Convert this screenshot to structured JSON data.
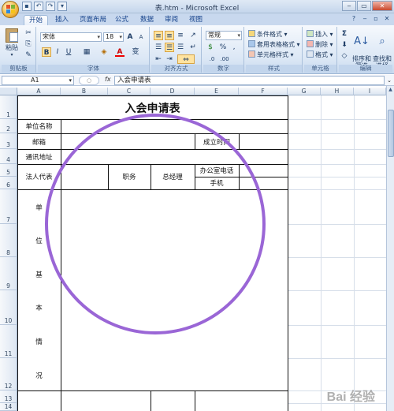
{
  "window": {
    "title": "表.htm - Microsoft Excel",
    "min": "‒",
    "max": "▭",
    "close": "✕"
  },
  "tabs": [
    "开始",
    "插入",
    "页面布局",
    "公式",
    "数据",
    "审阅",
    "视图"
  ],
  "ribbon": {
    "clipboard": {
      "label": "剪贴板",
      "paste": "粘贴"
    },
    "font": {
      "label": "字体",
      "name": "宋体",
      "size": "18",
      "grow": "A",
      "shrink": "A",
      "bold": "B",
      "italic": "I",
      "underline": "U",
      "color_a": "A",
      "wen": "变"
    },
    "alignment": {
      "label": "对齐方式"
    },
    "number": {
      "label": "数字",
      "format": "常规",
      "percent": "%",
      "comma": ","
    },
    "styles": {
      "label": "样式",
      "conditional": "条件格式",
      "table": "套用表格格式",
      "cell": "单元格样式"
    },
    "cells": {
      "label": "单元格",
      "insert": "插入",
      "delete": "删除",
      "format": "格式"
    },
    "editing": {
      "label": "编辑",
      "sort": "排序和\n筛选",
      "find": "查找和\n选择",
      "sum": "Σ"
    }
  },
  "formula": {
    "cell_ref": "A1",
    "fx": "fx",
    "content": "入会申请表"
  },
  "columns": [
    "A",
    "B",
    "C",
    "D",
    "E",
    "F",
    "G",
    "H",
    "I"
  ],
  "rows": [
    "1",
    "2",
    "3",
    "4",
    "5",
    "6",
    "7",
    "8",
    "9",
    "10",
    "11",
    "12",
    "13",
    "14"
  ],
  "sheet": {
    "title": "入会申请表",
    "unit_name": "单位名称",
    "mailbox": "邮箱",
    "established": "成立时间",
    "address": "通讯地址",
    "legal_rep": "法人代表",
    "position": "职务",
    "gm": "总经理",
    "office_phone": "办公室电话",
    "mobile": "手机",
    "basic_info_chars": [
      "单",
      "位",
      "基",
      "本",
      "情",
      "况"
    ]
  },
  "watermark": "Bai 经验",
  "colors": {
    "ribbon": "#dbe7f5",
    "circle": "#9a66d6",
    "header": "#dce6f2"
  }
}
